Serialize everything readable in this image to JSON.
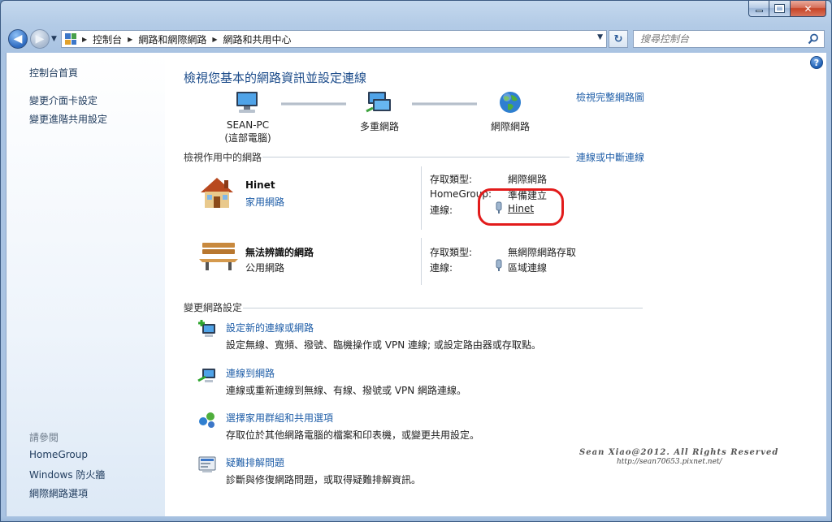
{
  "window": {
    "caption": {
      "minimize": "minimize-icon",
      "maximize": "maximize-icon",
      "close": "close-icon",
      "close_glyph": "✕"
    }
  },
  "nav": {
    "breadcrumbs": [
      "控制台",
      "網路和網際網路",
      "網路和共用中心"
    ],
    "search_placeholder": "搜尋控制台"
  },
  "sidebar": {
    "links": [
      "控制台首頁",
      "變更介面卡設定",
      "變更進階共用設定"
    ],
    "see_also_label": "請參閱",
    "see_also": [
      "HomeGroup",
      "Windows 防火牆",
      "網際網路選項"
    ]
  },
  "main": {
    "title": "檢視您基本的網路資訊並設定連線",
    "full_map_link": "檢視完整網路圖",
    "map": {
      "pc_name": "SEAN-PC",
      "pc_sub": "(這部電腦)",
      "network": "多重網路",
      "internet": "網際網路"
    },
    "active_header": "檢視作用中的網路",
    "connect_link": "連線或中斷連線",
    "networks": [
      {
        "name": "Hinet",
        "type": "家用網路",
        "access_label": "存取類型:",
        "access_value": "網際網路",
        "homegroup_label": "HomeGroup:",
        "homegroup_value": "準備建立",
        "conn_label": "連線:",
        "conn_value": "Hinet"
      },
      {
        "name": "無法辨識的網路",
        "type": "公用網路",
        "access_label": "存取類型:",
        "access_value": "無網際網路存取",
        "conn_label": "連線:",
        "conn_value": "區域連線"
      }
    ],
    "change_header": "變更網路設定",
    "tasks": [
      {
        "title": "設定新的連線或網路",
        "desc": "設定無線、寬頻、撥號、臨機操作或 VPN 連線; 或設定路由器或存取點。"
      },
      {
        "title": "連線到網路",
        "desc": "連線或重新連線到無線、有線、撥號或 VPN 網路連線。"
      },
      {
        "title": "選擇家用群組和共用選項",
        "desc": "存取位於其他網路電腦的檔案和印表機，或變更共用設定。"
      },
      {
        "title": "疑難排解問題",
        "desc": "診斷與修復網路問題，或取得疑難排解資訊。"
      }
    ],
    "watermark": "Sean Xiao@2012. All Rights Reserved",
    "watermark_url": "http://sean70653.pixnet.net/"
  },
  "colors": {
    "link": "#1f5ea8",
    "title": "#1b4b8a",
    "annotation": "#e21b1b"
  }
}
